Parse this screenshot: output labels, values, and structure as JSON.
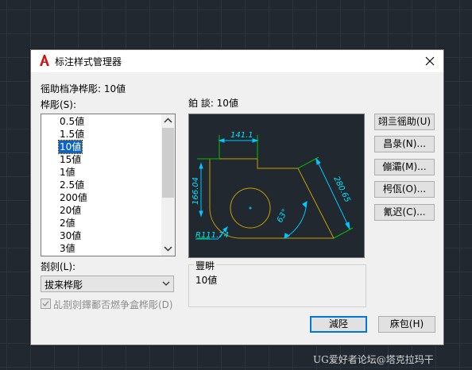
{
  "dialog": {
    "title": "标注样式管理器",
    "current_style_label": "徭助档净桦彫:  10値",
    "styles_label": "桦彫(S):",
    "preview_label": "鉑 談:  10値",
    "styles": [
      "0.5値",
      "1.5値",
      "10値",
      "15値",
      "1値",
      "2.5値",
      "200値",
      "20値",
      "2値",
      "30値",
      "3値"
    ],
    "selected_style": "10値",
    "list_label": "剳剠(L):",
    "list_value": "拔来桦彫",
    "checkbox_label": "乩剳剠鐸鄱否燃争盒桦彫(D)",
    "checkbox_checked": true,
    "description_title": "豐畊",
    "description_text": "10値"
  },
  "buttons": {
    "set_current": "翊亖徭助(U)",
    "new": "昌彔(N)...",
    "modify": "傰灞(M)...",
    "override": "枵佤(O)...",
    "compare": "氰迟(C)...",
    "close": "減陉",
    "help": "庥包(H)"
  },
  "preview_dims": {
    "top": "141.1",
    "left": "166.04",
    "diagonal": "280.65",
    "angle": "63°",
    "radius": "R111.74"
  },
  "watermark": "UG爱好者论坛@塔克拉玛干",
  "colors": {
    "accent": "#0078d7",
    "selection": "#0a64c8",
    "dim_line": "#00c8ff",
    "dim_text": "#00e5ff",
    "extension_line": "#00c000",
    "geometry": "#c8a000",
    "preview_bg": "#212830"
  }
}
